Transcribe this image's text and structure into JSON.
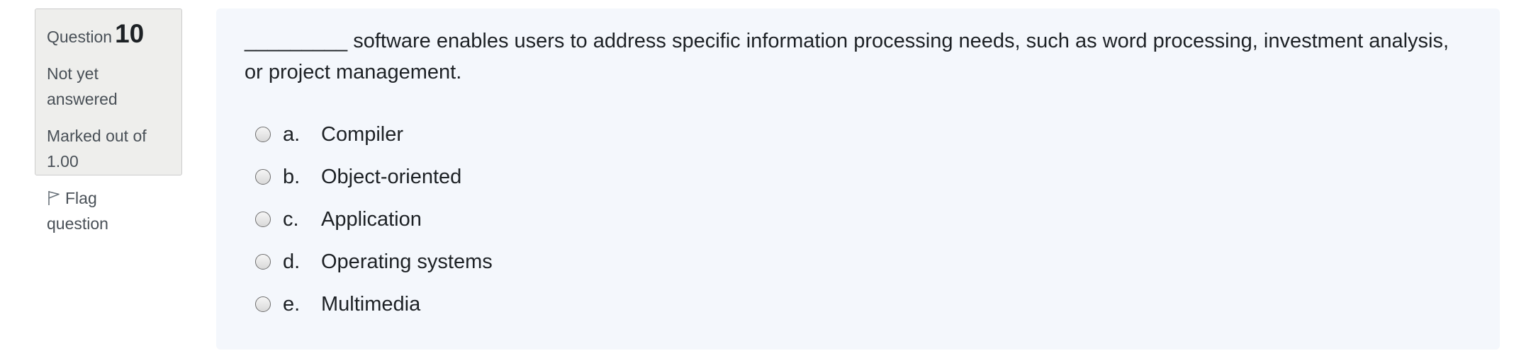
{
  "question_info": {
    "label": "Question",
    "number": "10",
    "state_line1": "Not yet",
    "state_line2": "answered",
    "marks_line1": "Marked out of",
    "marks_line2": "1.00",
    "flag_line1": "Flag",
    "flag_line2": "question",
    "flag_icon": "flag-icon"
  },
  "question": {
    "text": "_________ software enables users to address specific information processing needs, such as word processing, investment analysis, or project management.",
    "answers": [
      {
        "letter": "a.",
        "text": "Compiler"
      },
      {
        "letter": "b.",
        "text": "Object-oriented"
      },
      {
        "letter": "c.",
        "text": "Application"
      },
      {
        "letter": "d.",
        "text": "Operating systems"
      },
      {
        "letter": "e.",
        "text": "Multimedia"
      }
    ]
  }
}
